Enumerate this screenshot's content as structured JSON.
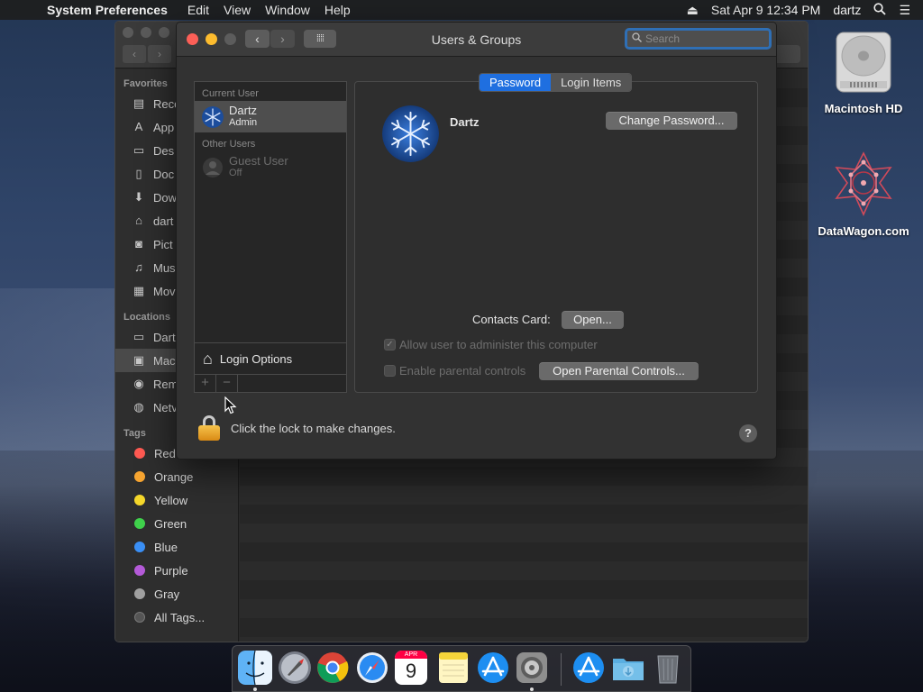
{
  "menubar": {
    "app_name": "System Preferences",
    "menus": [
      "Edit",
      "View",
      "Window",
      "Help"
    ],
    "datetime": "Sat Apr 9  12:34 PM",
    "user": "dartz"
  },
  "finder": {
    "favorites_header": "Favorites",
    "favorites": [
      "Rece",
      "App",
      "Des",
      "Doc",
      "Dow",
      "dart",
      "Pict",
      "Mus",
      "Mov"
    ],
    "locations_header": "Locations",
    "locations": [
      "Dart",
      "Mac",
      "Rem",
      "Netv"
    ],
    "tags_header": "Tags",
    "tags": [
      {
        "label": "Red",
        "color": "#ff5a52"
      },
      {
        "label": "Orange",
        "color": "#f7a531"
      },
      {
        "label": "Yellow",
        "color": "#f5d72a"
      },
      {
        "label": "Green",
        "color": "#3fd14b"
      },
      {
        "label": "Blue",
        "color": "#3a8ff5"
      },
      {
        "label": "Purple",
        "color": "#b45ad8"
      },
      {
        "label": "Gray",
        "color": "#a0a0a0"
      },
      {
        "label": "All Tags...",
        "color": "#555555"
      }
    ]
  },
  "prefs": {
    "title": "Users & Groups",
    "search_placeholder": "Search",
    "current_user_header": "Current User",
    "current_user": {
      "name": "Dartz",
      "role": "Admin"
    },
    "other_users_header": "Other Users",
    "guest_user": {
      "name": "Guest User",
      "status": "Off"
    },
    "login_options": "Login Options",
    "add_symbol": "+",
    "remove_symbol": "−",
    "tabs": [
      "Password",
      "Login Items"
    ],
    "active_tab": "Password",
    "display_name": "Dartz",
    "change_password": "Change Password...",
    "contacts_card_label": "Contacts Card:",
    "open_button": "Open...",
    "allow_admin": "Allow user to administer this computer",
    "allow_admin_checked": true,
    "parental_controls": "Enable parental controls",
    "parental_checked": false,
    "open_parental": "Open Parental Controls...",
    "lock_text": "Click the lock to make changes.",
    "help": "?"
  },
  "desktop": {
    "hd_label": "Macintosh HD",
    "datawagon_label": "DataWagon.com"
  },
  "dock": {
    "items": [
      "finder-icon",
      "launchpad-icon",
      "chrome-icon",
      "safari-icon",
      "calendar-icon",
      "notes-icon",
      "app-store-icon",
      "system-preferences-icon",
      "app-store-icon",
      "downloads-folder-icon",
      "trash-icon"
    ],
    "calendar_month": "APR",
    "calendar_day": "9"
  }
}
